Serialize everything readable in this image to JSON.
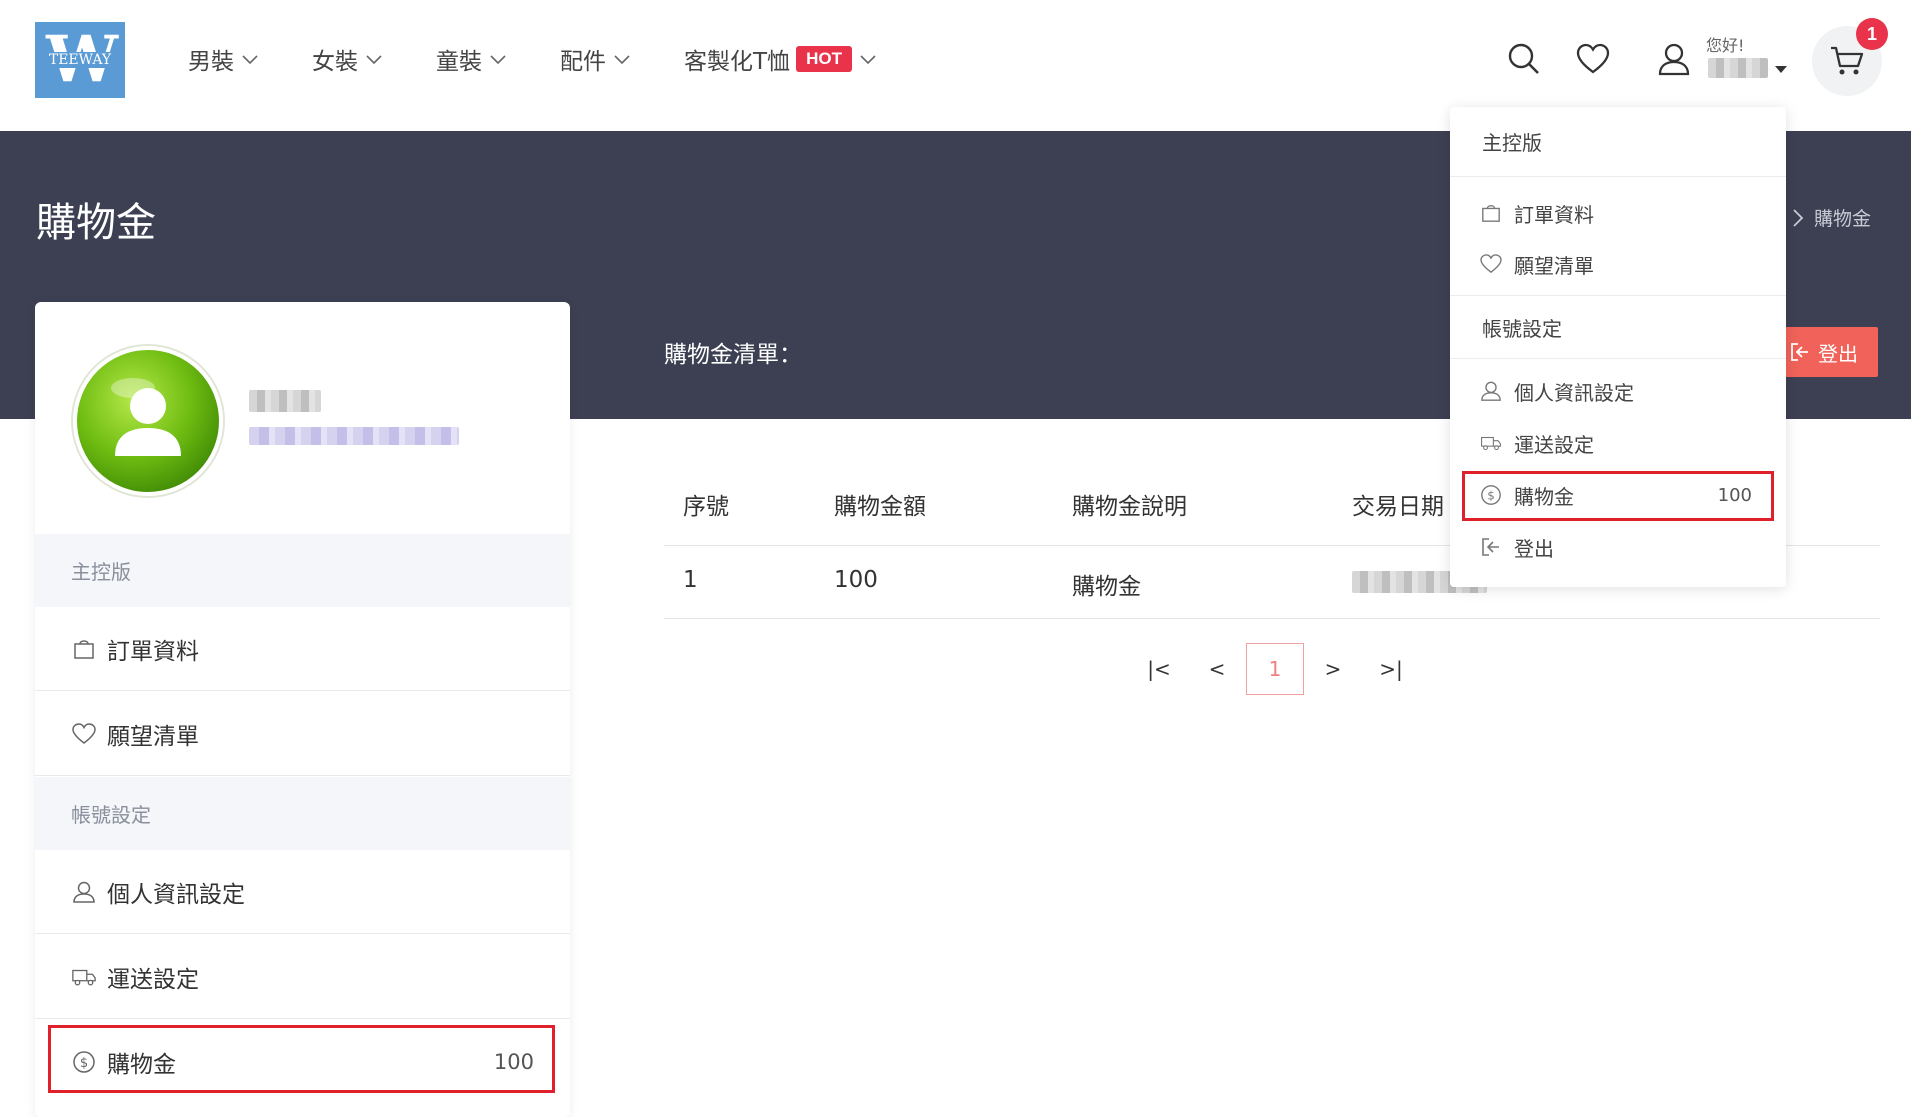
{
  "header": {
    "logo_letter": "W",
    "logo_brand": "TEEWAY",
    "nav": [
      {
        "label": "男裝"
      },
      {
        "label": "女裝"
      },
      {
        "label": "童裝"
      },
      {
        "label": "配件"
      },
      {
        "label": "客製化T恤",
        "badge": "HOT"
      }
    ],
    "greeting": "您好!",
    "cart_count": "1"
  },
  "banner": {
    "page_title": "購物金",
    "breadcrumb_current": "購物金",
    "list_title": "購物金清單：",
    "logout_label": "登出"
  },
  "sidebar": {
    "section_dashboard": "主控版",
    "orders": "訂單資料",
    "wishlist": "願望清單",
    "section_account": "帳號設定",
    "profile": "個人資訊設定",
    "shipping": "運送設定",
    "credit": "購物金",
    "credit_value": "100"
  },
  "table": {
    "headers": [
      "序號",
      "購物金額",
      "購物金說明",
      "交易日期"
    ],
    "rows": [
      {
        "no": "1",
        "amount": "100",
        "desc": "購物金"
      }
    ]
  },
  "pager": {
    "first": "|<",
    "prev": "<",
    "current": "1",
    "next": ">",
    "last": ">|"
  },
  "dropdown": {
    "dashboard": "主控版",
    "orders": "訂單資料",
    "wishlist": "願望清單",
    "account": "帳號設定",
    "profile": "個人資訊設定",
    "shipping": "運送設定",
    "credit": "購物金",
    "credit_value": "100",
    "logout": "登出"
  },
  "colors": {
    "banner": "#3c4052",
    "accent_red": "#e8334a",
    "logout_btn": "#f0625a",
    "highlight": "#e0202a"
  }
}
